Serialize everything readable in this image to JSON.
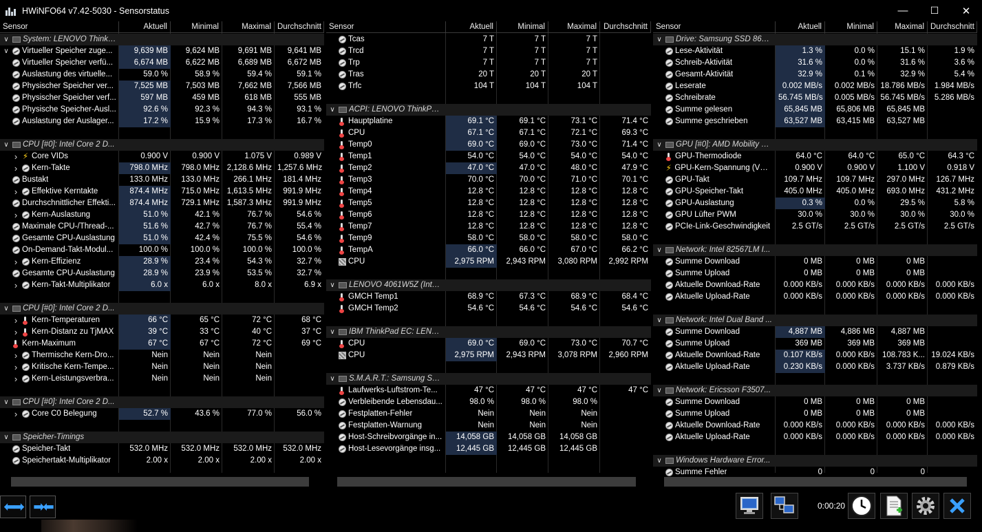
{
  "window": {
    "title": "HWiNFO64 v7.42-5030 - Sensorstatus",
    "minimize_glyph": "—",
    "maximize_glyph": "☐",
    "close_glyph": "✕"
  },
  "columns": {
    "sensor": "Sensor",
    "current": "Aktuell",
    "min": "Minimal",
    "max": "Maximal",
    "avg": "Durchschnitt"
  },
  "panel1": [
    {
      "type": "group",
      "label": "System: LENOVO ThinkP..."
    },
    {
      "exp": "v",
      "icon": "meter",
      "label": "Virtueller Speicher zuge...",
      "c": "9,639 MB",
      "mi": "9,624 MB",
      "ma": "9,691 MB",
      "av": "9,641 MB",
      "sel": true
    },
    {
      "exp": "",
      "icon": "meter",
      "label": "Virtueller Speicher verfü...",
      "c": "6,674 MB",
      "mi": "6,622 MB",
      "ma": "6,689 MB",
      "av": "6,672 MB",
      "sel": true
    },
    {
      "exp": "",
      "icon": "meter",
      "label": "Auslastung des virtuelle...",
      "c": "59.0 %",
      "mi": "58.9 %",
      "ma": "59.4 %",
      "av": "59.1 %"
    },
    {
      "exp": "",
      "icon": "meter",
      "label": "Physischer Speicher ver...",
      "c": "7,525 MB",
      "mi": "7,503 MB",
      "ma": "7,662 MB",
      "av": "7,566 MB",
      "sel": true
    },
    {
      "exp": "",
      "icon": "meter",
      "label": "Physischer Speicher verf...",
      "c": "597 MB",
      "mi": "459 MB",
      "ma": "618 MB",
      "av": "555 MB",
      "sel": true
    },
    {
      "exp": "",
      "icon": "meter",
      "label": "Physische Speicher-Ausl...",
      "c": "92.6 %",
      "mi": "92.3 %",
      "ma": "94.3 %",
      "av": "93.1 %",
      "sel": true
    },
    {
      "exp": "",
      "icon": "meter",
      "label": "Auslastung der Auslager...",
      "c": "17.2 %",
      "mi": "15.9 %",
      "ma": "17.3 %",
      "av": "16.7 %",
      "sel": true
    },
    {
      "type": "blank"
    },
    {
      "type": "group",
      "label": "CPU [#0]: Intel Core 2 D..."
    },
    {
      "exp": ">",
      "icon": "bolt",
      "label": "Core VIDs",
      "c": "0.900 V",
      "mi": "0.900 V",
      "ma": "1.075 V",
      "av": "0.989 V",
      "sub": true
    },
    {
      "exp": ">",
      "icon": "meter",
      "label": "Kern-Takte",
      "c": "798.0 MHz",
      "mi": "798.0 MHz",
      "ma": "2,128.6 MHz",
      "av": "1,257.6 MHz",
      "sub": true,
      "sel": true
    },
    {
      "exp": "",
      "icon": "meter",
      "label": "Bustakt",
      "c": "133.0 MHz",
      "mi": "133.0 MHz",
      "ma": "266.1 MHz",
      "av": "181.4 MHz"
    },
    {
      "exp": ">",
      "icon": "meter",
      "label": "Effektive Kerntakte",
      "c": "874.4 MHz",
      "mi": "715.0 MHz",
      "ma": "1,613.5 MHz",
      "av": "991.9 MHz",
      "sub": true,
      "sel": true
    },
    {
      "exp": "",
      "icon": "meter",
      "label": "Durchschnittlicher Effekti...",
      "c": "874.4 MHz",
      "mi": "729.1 MHz",
      "ma": "1,587.3 MHz",
      "av": "991.9 MHz",
      "sel": true
    },
    {
      "exp": ">",
      "icon": "meter",
      "label": "Kern-Auslastung",
      "c": "51.0 %",
      "mi": "42.1 %",
      "ma": "76.7 %",
      "av": "54.6 %",
      "sub": true,
      "sel": true
    },
    {
      "exp": "",
      "icon": "meter",
      "label": "Maximale CPU-/Thread-...",
      "c": "51.6 %",
      "mi": "42.7 %",
      "ma": "76.7 %",
      "av": "55.4 %",
      "sel": true
    },
    {
      "exp": "",
      "icon": "meter",
      "label": "Gesamte CPU-Auslastung",
      "c": "51.0 %",
      "mi": "42.4 %",
      "ma": "75.5 %",
      "av": "54.6 %",
      "sel": true
    },
    {
      "exp": "",
      "icon": "meter",
      "label": "On-Demand-Takt-Modul...",
      "c": "100.0 %",
      "mi": "100.0 %",
      "ma": "100.0 %",
      "av": "100.0 %"
    },
    {
      "exp": ">",
      "icon": "meter",
      "label": "Kern-Effizienz",
      "c": "28.9 %",
      "mi": "23.4 %",
      "ma": "54.3 %",
      "av": "32.7 %",
      "sub": true,
      "sel": true
    },
    {
      "exp": "",
      "icon": "meter",
      "label": "Gesamte CPU-Auslastung",
      "c": "28.9 %",
      "mi": "23.9 %",
      "ma": "53.5 %",
      "av": "32.7 %",
      "sel": true
    },
    {
      "exp": ">",
      "icon": "meter",
      "label": "Kern-Takt-Multiplikator",
      "c": "6.0 x",
      "mi": "6.0 x",
      "ma": "8.0 x",
      "av": "6.9 x",
      "sub": true,
      "sel": true
    },
    {
      "type": "blank"
    },
    {
      "type": "group",
      "label": "CPU [#0]: Intel Core 2 D..."
    },
    {
      "exp": ">",
      "icon": "therm",
      "label": "Kern-Temperaturen",
      "c": "66 °C",
      "mi": "65 °C",
      "ma": "72 °C",
      "av": "68 °C",
      "sub": true,
      "sel": true
    },
    {
      "exp": ">",
      "icon": "therm",
      "label": "Kern-Distanz zu TjMAX",
      "c": "39 °C",
      "mi": "33 °C",
      "ma": "40 °C",
      "av": "37 °C",
      "sub": true,
      "sel": true
    },
    {
      "exp": "",
      "icon": "therm",
      "label": "Kern-Maximum",
      "c": "67 °C",
      "mi": "67 °C",
      "ma": "72 °C",
      "av": "69 °C",
      "sel": true
    },
    {
      "exp": ">",
      "icon": "meter",
      "label": "Thermische Kern-Dro...",
      "c": "Nein",
      "mi": "Nein",
      "ma": "Nein",
      "av": "",
      "sub": true
    },
    {
      "exp": ">",
      "icon": "meter",
      "label": "Kritische Kern-Tempe...",
      "c": "Nein",
      "mi": "Nein",
      "ma": "Nein",
      "av": "",
      "sub": true
    },
    {
      "exp": ">",
      "icon": "meter",
      "label": "Kern-Leistungsverbra...",
      "c": "Nein",
      "mi": "Nein",
      "ma": "Nein",
      "av": "",
      "sub": true
    },
    {
      "type": "blank"
    },
    {
      "type": "group",
      "label": "CPU [#0]: Intel Core 2 D..."
    },
    {
      "exp": ">",
      "icon": "meter",
      "label": "Core C0 Belegung",
      "c": "52.7 %",
      "mi": "43.6 %",
      "ma": "77.0 %",
      "av": "56.0 %",
      "sub": true,
      "sel": true
    },
    {
      "type": "blank"
    },
    {
      "type": "group",
      "label": "Speicher-Timings"
    },
    {
      "exp": "",
      "icon": "meter",
      "label": "Speicher-Takt",
      "c": "532.0 MHz",
      "mi": "532.0 MHz",
      "ma": "532.0 MHz",
      "av": "532.0 MHz"
    },
    {
      "exp": "",
      "icon": "meter",
      "label": "Speichertakt-Multiplikator",
      "c": "2.00 x",
      "mi": "2.00 x",
      "ma": "2.00 x",
      "av": "2.00 x"
    }
  ],
  "panel2": [
    {
      "exp": "",
      "icon": "meter",
      "label": "Tcas",
      "c": "7 T",
      "mi": "7 T",
      "ma": "7 T",
      "av": ""
    },
    {
      "exp": "",
      "icon": "meter",
      "label": "Trcd",
      "c": "7 T",
      "mi": "7 T",
      "ma": "7 T",
      "av": ""
    },
    {
      "exp": "",
      "icon": "meter",
      "label": "Trp",
      "c": "7 T",
      "mi": "7 T",
      "ma": "7 T",
      "av": ""
    },
    {
      "exp": "",
      "icon": "meter",
      "label": "Tras",
      "c": "20 T",
      "mi": "20 T",
      "ma": "20 T",
      "av": ""
    },
    {
      "exp": "",
      "icon": "meter",
      "label": "Trfc",
      "c": "104 T",
      "mi": "104 T",
      "ma": "104 T",
      "av": ""
    },
    {
      "type": "blank"
    },
    {
      "type": "group",
      "label": "ACPI: LENOVO ThinkPad..."
    },
    {
      "exp": "",
      "icon": "therm",
      "label": "Hauptplatine",
      "c": "69.1 °C",
      "mi": "69.1 °C",
      "ma": "73.1 °C",
      "av": "71.4 °C",
      "sel": true
    },
    {
      "exp": "",
      "icon": "therm",
      "label": "CPU",
      "c": "67.1 °C",
      "mi": "67.1 °C",
      "ma": "72.1 °C",
      "av": "69.3 °C",
      "sel": true
    },
    {
      "exp": "",
      "icon": "therm",
      "label": "Temp0",
      "c": "69.0 °C",
      "mi": "69.0 °C",
      "ma": "73.0 °C",
      "av": "71.4 °C",
      "sel": true
    },
    {
      "exp": "",
      "icon": "therm",
      "label": "Temp1",
      "c": "54.0 °C",
      "mi": "54.0 °C",
      "ma": "54.0 °C",
      "av": "54.0 °C"
    },
    {
      "exp": "",
      "icon": "therm",
      "label": "Temp2",
      "c": "47.0 °C",
      "mi": "47.0 °C",
      "ma": "48.0 °C",
      "av": "47.9 °C",
      "sel": true
    },
    {
      "exp": "",
      "icon": "therm",
      "label": "Temp3",
      "c": "70.0 °C",
      "mi": "70.0 °C",
      "ma": "71.0 °C",
      "av": "70.1 °C"
    },
    {
      "exp": "",
      "icon": "therm",
      "label": "Temp4",
      "c": "12.8 °C",
      "mi": "12.8 °C",
      "ma": "12.8 °C",
      "av": "12.8 °C"
    },
    {
      "exp": "",
      "icon": "therm",
      "label": "Temp5",
      "c": "12.8 °C",
      "mi": "12.8 °C",
      "ma": "12.8 °C",
      "av": "12.8 °C"
    },
    {
      "exp": "",
      "icon": "therm",
      "label": "Temp6",
      "c": "12.8 °C",
      "mi": "12.8 °C",
      "ma": "12.8 °C",
      "av": "12.8 °C"
    },
    {
      "exp": "",
      "icon": "therm",
      "label": "Temp7",
      "c": "12.8 °C",
      "mi": "12.8 °C",
      "ma": "12.8 °C",
      "av": "12.8 °C"
    },
    {
      "exp": "",
      "icon": "therm",
      "label": "Temp9",
      "c": "58.0 °C",
      "mi": "58.0 °C",
      "ma": "58.0 °C",
      "av": "58.0 °C"
    },
    {
      "exp": "",
      "icon": "therm",
      "label": "TempA",
      "c": "66.0 °C",
      "mi": "66.0 °C",
      "ma": "67.0 °C",
      "av": "66.2 °C",
      "sel": true
    },
    {
      "exp": "",
      "icon": "fan",
      "label": "CPU",
      "c": "2,975 RPM",
      "mi": "2,943 RPM",
      "ma": "3,080 RPM",
      "av": "2,992 RPM",
      "sel": true
    },
    {
      "type": "blank"
    },
    {
      "type": "group",
      "label": "LENOVO 4061W5Z (Intel..."
    },
    {
      "exp": "",
      "icon": "therm",
      "label": "GMCH Temp1",
      "c": "68.9 °C",
      "mi": "67.3 °C",
      "ma": "68.9 °C",
      "av": "68.4 °C"
    },
    {
      "exp": "",
      "icon": "therm",
      "label": "GMCH Temp2",
      "c": "54.6 °C",
      "mi": "54.6 °C",
      "ma": "54.6 °C",
      "av": "54.6 °C"
    },
    {
      "type": "blank"
    },
    {
      "type": "group",
      "label": "IBM ThinkPad EC: LENOV..."
    },
    {
      "exp": "",
      "icon": "therm",
      "label": "CPU",
      "c": "69.0 °C",
      "mi": "69.0 °C",
      "ma": "73.0 °C",
      "av": "70.7 °C",
      "sel": true
    },
    {
      "exp": "",
      "icon": "fan",
      "label": "CPU",
      "c": "2,975 RPM",
      "mi": "2,943 RPM",
      "ma": "3,078 RPM",
      "av": "2,960 RPM",
      "sel": true
    },
    {
      "type": "blank"
    },
    {
      "type": "group",
      "label": "S.M.A.R.T.: Samsung SS..."
    },
    {
      "exp": "",
      "icon": "therm",
      "label": "Laufwerks-Luftstrom-Te...",
      "c": "47 °C",
      "mi": "47 °C",
      "ma": "47 °C",
      "av": "47 °C"
    },
    {
      "exp": "",
      "icon": "meter",
      "label": "Verbleibende Lebensdau...",
      "c": "98.0 %",
      "mi": "98.0 %",
      "ma": "98.0 %",
      "av": ""
    },
    {
      "exp": "",
      "icon": "meter",
      "label": "Festplatten-Fehler",
      "c": "Nein",
      "mi": "Nein",
      "ma": "Nein",
      "av": ""
    },
    {
      "exp": "",
      "icon": "meter",
      "label": "Festplatten-Warnung",
      "c": "Nein",
      "mi": "Nein",
      "ma": "Nein",
      "av": ""
    },
    {
      "exp": "",
      "icon": "meter",
      "label": "Host-Schreibvorgänge in...",
      "c": "14,058 GB",
      "mi": "14,058 GB",
      "ma": "14,058 GB",
      "av": "",
      "sel": true
    },
    {
      "exp": "",
      "icon": "meter",
      "label": "Host-Lesevorgänge insg...",
      "c": "12,445 GB",
      "mi": "12,445 GB",
      "ma": "12,445 GB",
      "av": "",
      "sel": true
    }
  ],
  "panel3": [
    {
      "type": "group",
      "label": "Drive: Samsung SSD 860 ..."
    },
    {
      "exp": "",
      "icon": "meter",
      "label": "Lese-Aktivität",
      "c": "1.3 %",
      "mi": "0.0 %",
      "ma": "15.1 %",
      "av": "1.9 %",
      "sel": true
    },
    {
      "exp": "",
      "icon": "meter",
      "label": "Schreib-Aktivität",
      "c": "31.6 %",
      "mi": "0.0 %",
      "ma": "31.6 %",
      "av": "3.6 %",
      "sel": true
    },
    {
      "exp": "",
      "icon": "meter",
      "label": "Gesamt-Aktivität",
      "c": "32.9 %",
      "mi": "0.1 %",
      "ma": "32.9 %",
      "av": "5.4 %",
      "sel": true
    },
    {
      "exp": "",
      "icon": "meter",
      "label": "Leserate",
      "c": "0.002 MB/s",
      "mi": "0.002 MB/s",
      "ma": "18.786 MB/s",
      "av": "1.984 MB/s",
      "sel": true
    },
    {
      "exp": "",
      "icon": "meter",
      "label": "Schreibrate",
      "c": "56.745 MB/s",
      "mi": "0.005 MB/s",
      "ma": "56.745 MB/s",
      "av": "5.286 MB/s",
      "sel": true
    },
    {
      "exp": "",
      "icon": "meter",
      "label": "Summe gelesen",
      "c": "65,845 MB",
      "mi": "65,806 MB",
      "ma": "65,845 MB",
      "av": "",
      "sel": true
    },
    {
      "exp": "",
      "icon": "meter",
      "label": "Summe geschrieben",
      "c": "63,527 MB",
      "mi": "63,415 MB",
      "ma": "63,527 MB",
      "av": "",
      "sel": true
    },
    {
      "type": "blank"
    },
    {
      "type": "group",
      "label": "GPU [#0]: AMD Mobility R..."
    },
    {
      "exp": "",
      "icon": "therm",
      "label": "GPU-Thermodiode",
      "c": "64.0 °C",
      "mi": "64.0 °C",
      "ma": "65.0 °C",
      "av": "64.3 °C"
    },
    {
      "exp": "",
      "icon": "bolt",
      "label": "GPU-Kern-Spannung (VDDC)",
      "c": "0.900 V",
      "mi": "0.900 V",
      "ma": "1.100 V",
      "av": "0.918 V"
    },
    {
      "exp": "",
      "icon": "meter",
      "label": "GPU-Takt",
      "c": "109.7 MHz",
      "mi": "109.7 MHz",
      "ma": "297.0 MHz",
      "av": "126.7 MHz"
    },
    {
      "exp": "",
      "icon": "meter",
      "label": "GPU-Speicher-Takt",
      "c": "405.0 MHz",
      "mi": "405.0 MHz",
      "ma": "693.0 MHz",
      "av": "431.2 MHz"
    },
    {
      "exp": "",
      "icon": "meter",
      "label": "GPU-Auslastung",
      "c": "0.3 %",
      "mi": "0.0 %",
      "ma": "29.5 %",
      "av": "5.8 %",
      "sel": true
    },
    {
      "exp": "",
      "icon": "meter",
      "label": "GPU Lüfter PWM",
      "c": "30.0 %",
      "mi": "30.0 %",
      "ma": "30.0 %",
      "av": "30.0 %"
    },
    {
      "exp": "",
      "icon": "meter",
      "label": "PCIe-Link-Geschwindigkeit",
      "c": "2.5 GT/s",
      "mi": "2.5 GT/s",
      "ma": "2.5 GT/s",
      "av": "2.5 GT/s"
    },
    {
      "type": "blank"
    },
    {
      "type": "group",
      "label": "Network: Intel 82567LM I..."
    },
    {
      "exp": "",
      "icon": "meter",
      "label": "Summe Download",
      "c": "0 MB",
      "mi": "0 MB",
      "ma": "0 MB",
      "av": ""
    },
    {
      "exp": "",
      "icon": "meter",
      "label": "Summe Upload",
      "c": "0 MB",
      "mi": "0 MB",
      "ma": "0 MB",
      "av": ""
    },
    {
      "exp": "",
      "icon": "meter",
      "label": "Aktuelle Download-Rate",
      "c": "0.000 KB/s",
      "mi": "0.000 KB/s",
      "ma": "0.000 KB/s",
      "av": "0.000 KB/s"
    },
    {
      "exp": "",
      "icon": "meter",
      "label": "Aktuelle Upload-Rate",
      "c": "0.000 KB/s",
      "mi": "0.000 KB/s",
      "ma": "0.000 KB/s",
      "av": "0.000 KB/s"
    },
    {
      "type": "blank"
    },
    {
      "type": "group",
      "label": "Network: Intel Dual Band ..."
    },
    {
      "exp": "",
      "icon": "meter",
      "label": "Summe Download",
      "c": "4,887 MB",
      "mi": "4,886 MB",
      "ma": "4,887 MB",
      "av": "",
      "sel": true
    },
    {
      "exp": "",
      "icon": "meter",
      "label": "Summe Upload",
      "c": "369 MB",
      "mi": "369 MB",
      "ma": "369 MB",
      "av": ""
    },
    {
      "exp": "",
      "icon": "meter",
      "label": "Aktuelle Download-Rate",
      "c": "0.107 KB/s",
      "mi": "0.000 KB/s",
      "ma": "108.783 K...",
      "av": "19.024 KB/s",
      "sel": true
    },
    {
      "exp": "",
      "icon": "meter",
      "label": "Aktuelle Upload-Rate",
      "c": "0.230 KB/s",
      "mi": "0.000 KB/s",
      "ma": "3.737 KB/s",
      "av": "0.879 KB/s",
      "sel": true
    },
    {
      "type": "blank"
    },
    {
      "type": "group",
      "label": "Network: Ericsson F3507..."
    },
    {
      "exp": "",
      "icon": "meter",
      "label": "Summe Download",
      "c": "0 MB",
      "mi": "0 MB",
      "ma": "0 MB",
      "av": ""
    },
    {
      "exp": "",
      "icon": "meter",
      "label": "Summe Upload",
      "c": "0 MB",
      "mi": "0 MB",
      "ma": "0 MB",
      "av": ""
    },
    {
      "exp": "",
      "icon": "meter",
      "label": "Aktuelle Download-Rate",
      "c": "0.000 KB/s",
      "mi": "0.000 KB/s",
      "ma": "0.000 KB/s",
      "av": "0.000 KB/s"
    },
    {
      "exp": "",
      "icon": "meter",
      "label": "Aktuelle Upload-Rate",
      "c": "0.000 KB/s",
      "mi": "0.000 KB/s",
      "ma": "0.000 KB/s",
      "av": "0.000 KB/s"
    },
    {
      "type": "blank"
    },
    {
      "type": "group",
      "label": "Windows Hardware Error..."
    },
    {
      "exp": "",
      "icon": "meter",
      "label": "Summe Fehler",
      "c": "0",
      "mi": "0",
      "ma": "0",
      "av": ""
    }
  ],
  "toolbar": {
    "timer": "0:00:20",
    "icons": [
      "network-monitor-icon",
      "report-network-icon",
      "clock-icon",
      "add-report-icon",
      "settings-gear-icon",
      "close-x-icon"
    ]
  }
}
